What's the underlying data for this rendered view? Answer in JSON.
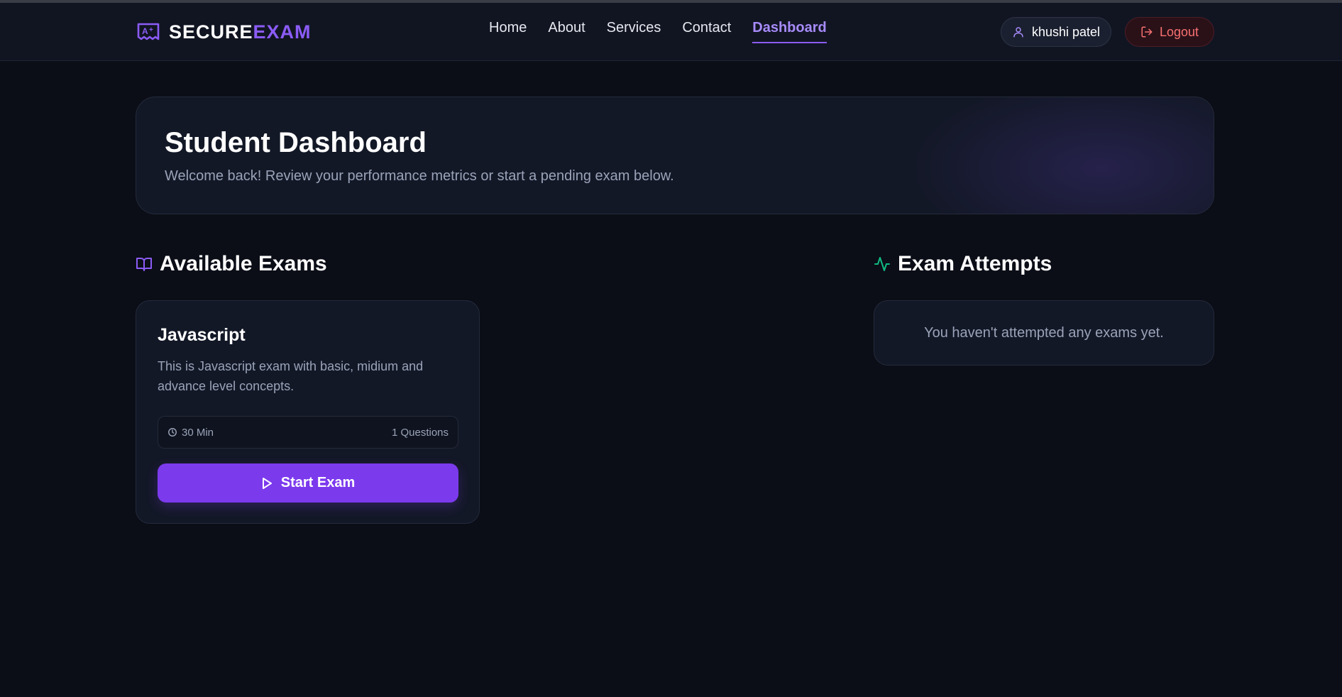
{
  "brand": {
    "part1": "SECURE",
    "part2": "EXAM",
    "icon": "exam-badge-icon"
  },
  "nav": {
    "items": [
      {
        "label": "Home",
        "active": false
      },
      {
        "label": "About",
        "active": false
      },
      {
        "label": "Services",
        "active": false
      },
      {
        "label": "Contact",
        "active": false
      },
      {
        "label": "Dashboard",
        "active": true
      }
    ]
  },
  "user": {
    "name": "khushi patel",
    "icon": "user-icon"
  },
  "logout": {
    "label": "Logout",
    "icon": "logout-icon"
  },
  "hero": {
    "title": "Student Dashboard",
    "subtitle": "Welcome back! Review your performance metrics or start a pending exam below."
  },
  "available_exams": {
    "title": "Available Exams",
    "icon": "book-open-icon",
    "exams": [
      {
        "title": "Javascript",
        "description": "This is Javascript exam with basic, midium and advance level concepts.",
        "duration": "30 Min",
        "questions": "1 Questions",
        "start_label": "Start Exam"
      }
    ]
  },
  "exam_attempts": {
    "title": "Exam Attempts",
    "icon": "activity-icon",
    "empty_text": "You haven't attempted any exams yet."
  },
  "colors": {
    "background": "#0b0e17",
    "accent": "#8b5cf6",
    "button": "#7c3aed",
    "danger": "#f87171",
    "success": "#10b981"
  }
}
